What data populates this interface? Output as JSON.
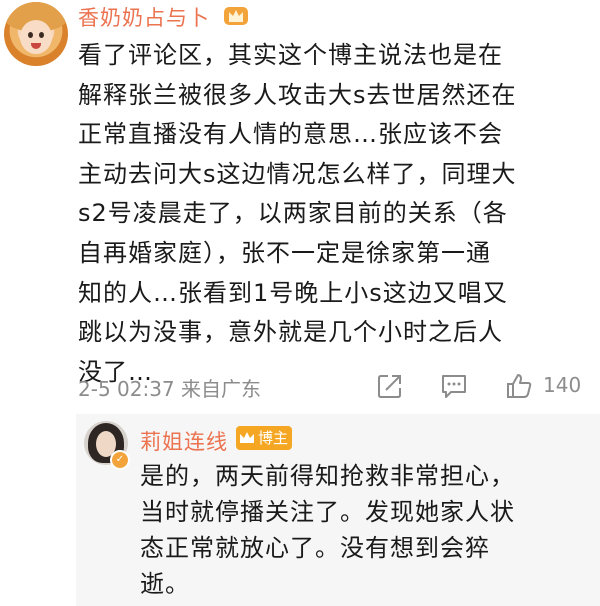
{
  "comment": {
    "username": "香奶奶占与卜",
    "text": "看了评论区，其实这个博主说法也是在\n解释张兰被很多人攻击大s去世居然还在\n正常直播没有人情的意思…张应该不会\n主动去问大s这边情况怎么样了，同理大\ns2号凌晨走了，以两家目前的关系（各\n自再婚家庭），张不一定是徐家第一通\n知的人…张看到1号晚上小s这边又唱又\n跳以为没事，意外就是几个小时之后人\n没了…",
    "meta": "2-5 02:37 来自广东",
    "like_count": "140"
  },
  "reply": {
    "username": "莉姐连线",
    "badge": "博主",
    "text": "是的，两天前得知抢救非常担心，\n当时就停播关注了。发现她家人状\n态正常就放心了。没有想到会猝\n逝。"
  },
  "icons": {
    "vip": "vip-crown-icon",
    "share": "share-icon",
    "comment": "comment-icon",
    "like": "thumbs-up-icon",
    "verified": "verified-badge-icon"
  },
  "colors": {
    "username": "#eb7350",
    "badge": "#f5a623",
    "meta": "#8c8c8c",
    "reply_bg": "#f6f6f6"
  }
}
